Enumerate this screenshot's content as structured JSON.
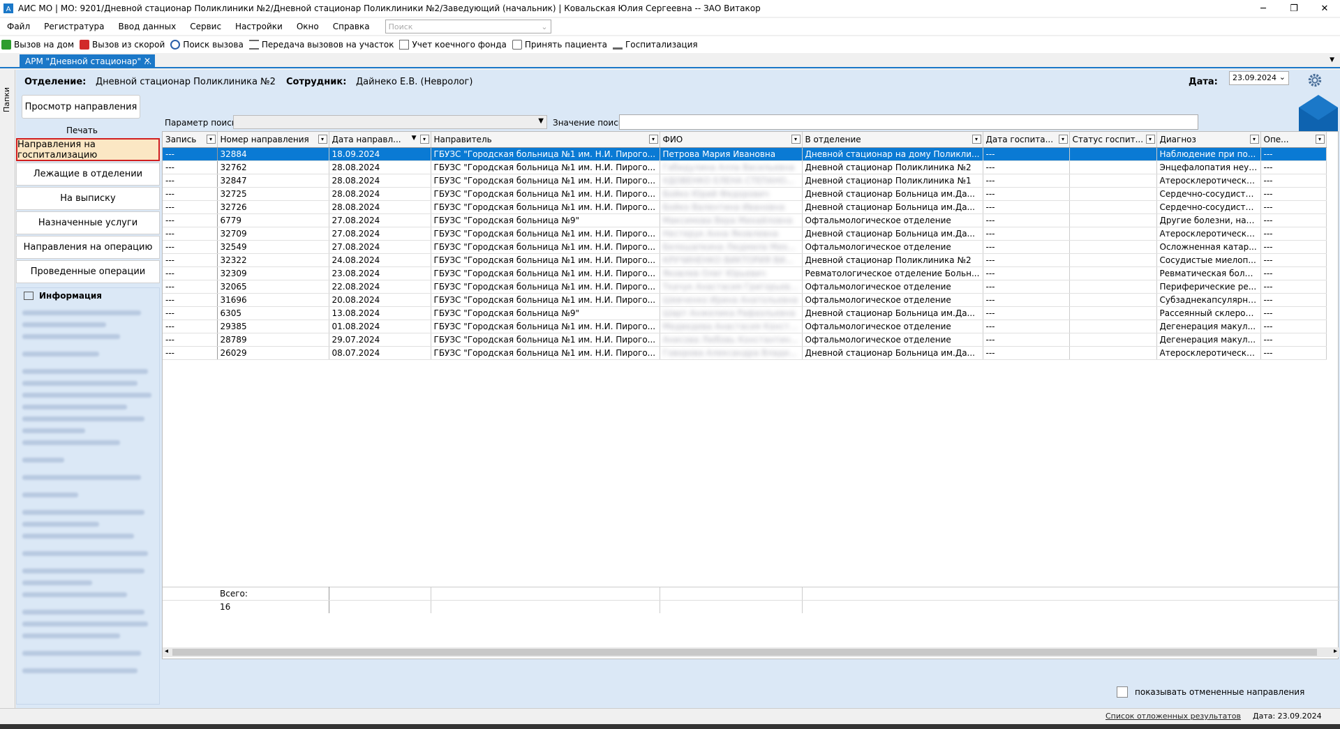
{
  "window": {
    "title": "АИС МО | МО: 9201/Дневной стационар Поликлиники №2/Дневной стационар Поликлиники №2/Заведующий (начальник) | Ковальская Юлия Сергеевна -- ЗАО Витакор",
    "minimize": "─",
    "maximize": "❐",
    "close": "✕"
  },
  "menu": {
    "items": [
      "Файл",
      "Регистратура",
      "Ввод данных",
      "Сервис",
      "Настройки",
      "Окно",
      "Справка"
    ],
    "search_placeholder": "Поиск"
  },
  "toolbar": {
    "items": [
      {
        "label": "Вызов на дом",
        "icon": "house-call-icon",
        "color": "#2e9d2e"
      },
      {
        "label": "Вызов из скорой",
        "icon": "ambulance-call-icon",
        "color": "#d12a2a"
      },
      {
        "label": "Поиск вызова",
        "icon": "search-call-icon",
        "color": "#2b5fa8"
      },
      {
        "label": "Передача вызовов на участок",
        "icon": "transfer-icon",
        "color": "#666666"
      },
      {
        "label": "Учет коечного фонда",
        "icon": "bed-fund-icon",
        "color": "#666666"
      },
      {
        "label": "Принять пациента",
        "icon": "accept-patient-icon",
        "color": "#666666"
      },
      {
        "label": "Госпитализация",
        "icon": "hospitalization-icon",
        "color": "#666666"
      }
    ]
  },
  "tab": {
    "label": "АРМ \"Дневной стационар\" ...",
    "close": "✕"
  },
  "side_panel": {
    "label": "Папки"
  },
  "header": {
    "department_label": "Отделение:",
    "department_value": "Дневной стационар Поликлиника №2",
    "employee_label": "Сотрудник:",
    "employee_value": "Дайнеко Е.В. (Невролог)",
    "date_label": "Дата:",
    "date_value": "23.09.2024"
  },
  "actions": {
    "view_referral": "Просмотр направления",
    "print": "Печать"
  },
  "nav": {
    "items": [
      "Направления на госпитализацию",
      "Лежащие в отделении",
      "На выписку",
      "Назначенные услуги",
      "Направления на операцию",
      "Проведенные операции"
    ]
  },
  "info": {
    "title": "Информация"
  },
  "search": {
    "param_label": "Параметр поиска",
    "value_label": "Значение поиска"
  },
  "grid": {
    "columns": [
      "Запись",
      "Номер направления",
      "Дата направл...",
      "Направитель",
      "ФИО",
      "В отделение",
      "Дата госпита...",
      "Статус госпит...",
      "Диагноз",
      "Опе..."
    ],
    "rows": [
      [
        "---",
        "32884",
        "18.09.2024",
        "ГБУЗС \"Городская больница №1 им. Н.И. Пирого...",
        "Петрова Мария Ивановна",
        "Дневной стационар на дому Поликли...",
        "---",
        "",
        "Наблюдение при по...",
        "---"
      ],
      [
        "---",
        "32762",
        "28.08.2024",
        "ГБУЗС \"Городская больница №1 им. Н.И. Пирого...",
        "Габидулина Алла Васильевна",
        "Дневной стационар Поликлиника №2",
        "---",
        "",
        "Энцефалопатия неут...",
        "---"
      ],
      [
        "---",
        "32847",
        "28.08.2024",
        "ГБУЗС \"Городская больница №1 им. Н.И. Пирого...",
        "УДОВЕНКО ЕЛЕНА СТЕПАНО...",
        "Дневной стационар Поликлиника №1",
        "---",
        "",
        "Атеросклеротическа...",
        "---"
      ],
      [
        "---",
        "32725",
        "28.08.2024",
        "ГБУЗС \"Городская больница №1 им. Н.И. Пирого...",
        "Бойко Юрий Федорович",
        "Дневной стационар Больница им.Да...",
        "---",
        "",
        "Сердечно-сосудиста...",
        "---"
      ],
      [
        "---",
        "32726",
        "28.08.2024",
        "ГБУЗС \"Городская больница №1 им. Н.И. Пирого...",
        "Бойко Валентина Ивановна",
        "Дневной стационар Больница им.Да...",
        "---",
        "",
        "Сердечно-сосудиста...",
        "---"
      ],
      [
        "---",
        "6779",
        "27.08.2024",
        "ГБУЗС \"Городская больница №9\"",
        "Максимова Вера Михайловна",
        "Офтальмологическое отделение",
        "---",
        "",
        "Другие болезни, нар...",
        "---"
      ],
      [
        "---",
        "32709",
        "27.08.2024",
        "ГБУЗС \"Городская больница №1 им. Н.И. Пирого...",
        "Нестерук Анна Яковлевна",
        "Дневной стационар Больница им.Да...",
        "---",
        "",
        "Атеросклеротическа...",
        "---"
      ],
      [
        "---",
        "32549",
        "27.08.2024",
        "ГБУЗС \"Городская больница №1 им. Н.И. Пирого...",
        "Белошапкина Людмила Мих...",
        "Офтальмологическое отделение",
        "---",
        "",
        "Осложненная катар...",
        "---"
      ],
      [
        "---",
        "32322",
        "24.08.2024",
        "ГБУЗС \"Городская больница №1 им. Н.И. Пирого...",
        "КРУЧИНЕНКО ВИКТОРИЯ ВИ...",
        "Дневной стационар Поликлиника №2",
        "---",
        "",
        "Сосудистые миелоп...",
        "---"
      ],
      [
        "---",
        "32309",
        "23.08.2024",
        "ГБУЗС \"Городская больница №1 им. Н.И. Пирого...",
        "Яковлев Олег Юрьевич",
        "Ревматологическое отделение Больн...",
        "---",
        "",
        "Ревматическая боле...",
        "---"
      ],
      [
        "---",
        "32065",
        "22.08.2024",
        "ГБУЗС \"Городская больница №1 им. Н.И. Пирого...",
        "Ткачук Анастасия Григорьевна",
        "Офтальмологическое отделение",
        "---",
        "",
        "Периферические ре...",
        "---"
      ],
      [
        "---",
        "31696",
        "20.08.2024",
        "ГБУЗС \"Городская больница №1 им. Н.И. Пирого...",
        "Шевченко Ирина Анатольевна",
        "Офтальмологическое отделение",
        "---",
        "",
        "Субзаднекапсулярна...",
        "---"
      ],
      [
        "---",
        "6305",
        "13.08.2024",
        "ГБУЗС \"Городская больница №9\"",
        "Шарт Анжелика Рафаэльевна",
        "Дневной стационар Больница им.Да...",
        "---",
        "",
        "Рассеянный склероз,...",
        "---"
      ],
      [
        "---",
        "29385",
        "01.08.2024",
        "ГБУЗС \"Городская больница №1 им. Н.И. Пирого...",
        "Медведева Анастасия Конста...",
        "Офтальмологическое отделение",
        "---",
        "",
        "Дегенерация макул...",
        "---"
      ],
      [
        "---",
        "28789",
        "29.07.2024",
        "ГБУЗС \"Городская больница №1 им. Н.И. Пирого...",
        "Анисова Любовь Константин...",
        "Офтальмологическое отделение",
        "---",
        "",
        "Дегенерация макул...",
        "---"
      ],
      [
        "---",
        "26029",
        "08.07.2024",
        "ГБУЗС \"Городская больница №1 им. Н.И. Пирого...",
        "Говорова Александра Влади...",
        "Дневной стационар Больница им.Да...",
        "---",
        "",
        "Атеросклеротическа...",
        "---"
      ]
    ],
    "total_label": "Всего:",
    "total_value": "16"
  },
  "checkbox": {
    "label": "показывать отмененные направления"
  },
  "status": {
    "pending_link": "Список отложенных результатов",
    "date": "Дата: 23.09.2024"
  },
  "colors": {
    "accent": "#1b78c8",
    "selected_row": "#0a7ad4",
    "active_nav_border": "#d21f1f",
    "panel_bg": "#dbe8f6"
  }
}
